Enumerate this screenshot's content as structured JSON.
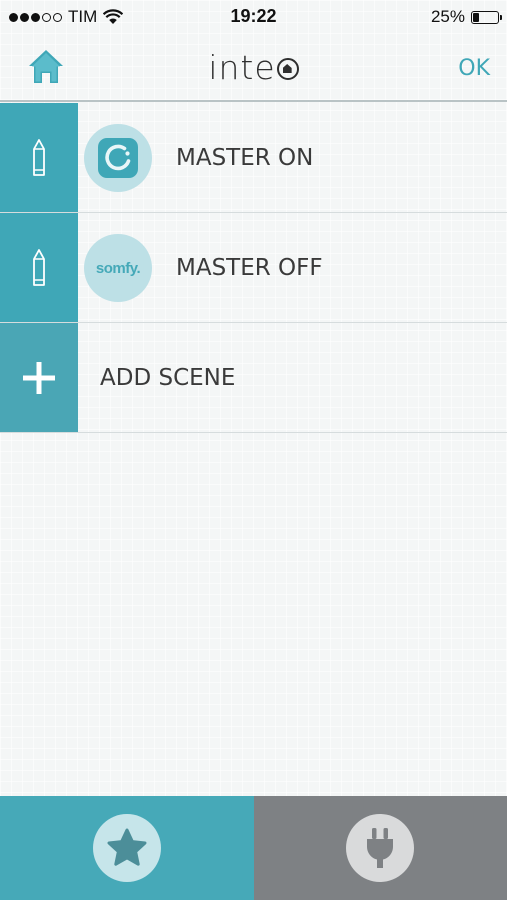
{
  "status_bar": {
    "carrier": "TIM",
    "time": "19:22",
    "battery_percent_text": "25%",
    "battery_level": 0.25,
    "signal_bars_filled": 3,
    "signal_bars_total": 5
  },
  "header": {
    "logo_text": "inte",
    "ok_label": "OK"
  },
  "scenes": [
    {
      "label": "MASTER ON",
      "icon": "scene-icon"
    },
    {
      "label": "MASTER OFF",
      "icon": "somfy-logo-icon",
      "icon_text": "somfy."
    }
  ],
  "add_scene": {
    "label": "ADD SCENE"
  },
  "tabs": [
    {
      "name": "favorites",
      "icon": "star-icon"
    },
    {
      "name": "devices",
      "icon": "plug-icon"
    }
  ],
  "colors": {
    "accent": "#3fa7b7",
    "tab_inactive": "#7e8184",
    "text": "#3a3a3a"
  }
}
